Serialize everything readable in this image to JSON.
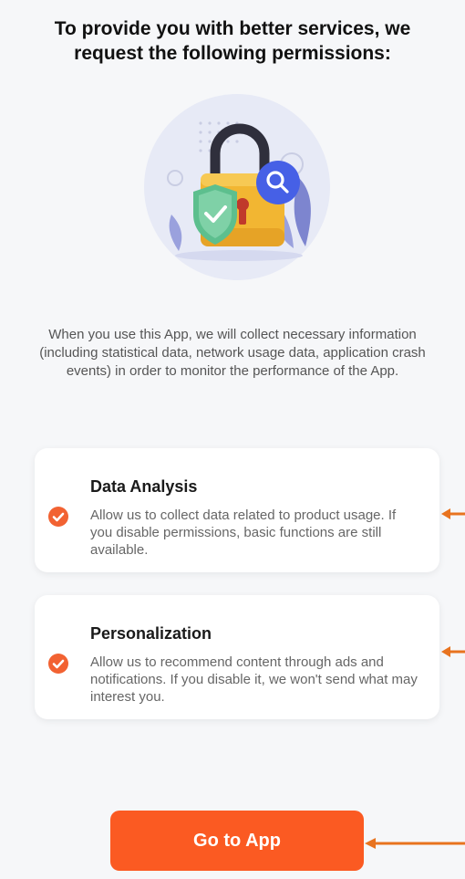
{
  "title": "To provide you with better services, we request the following permissions:",
  "description": "When you use this App, we will collect necessary information (including statistical data, network usage data, application crash events) in order to monitor the performance of the App.",
  "permissions": [
    {
      "title": "Data Analysis",
      "text": "Allow us to collect data related to product usage. If you disable permissions, basic functions are still available.",
      "checked": true
    },
    {
      "title": "Personalization",
      "text": "Allow us to recommend content through ads and notifications. If you disable it, we won't send what may interest you.",
      "checked": true
    }
  ],
  "button": {
    "label": "Go to App"
  },
  "colors": {
    "accent": "#fb5a22",
    "check": "#f26232",
    "annotation_arrow": "#e8731f"
  },
  "icons": [
    "padlock-icon",
    "magnifier-icon",
    "shield-check-icon",
    "check-circle-icon",
    "arrow-left-icon"
  ]
}
